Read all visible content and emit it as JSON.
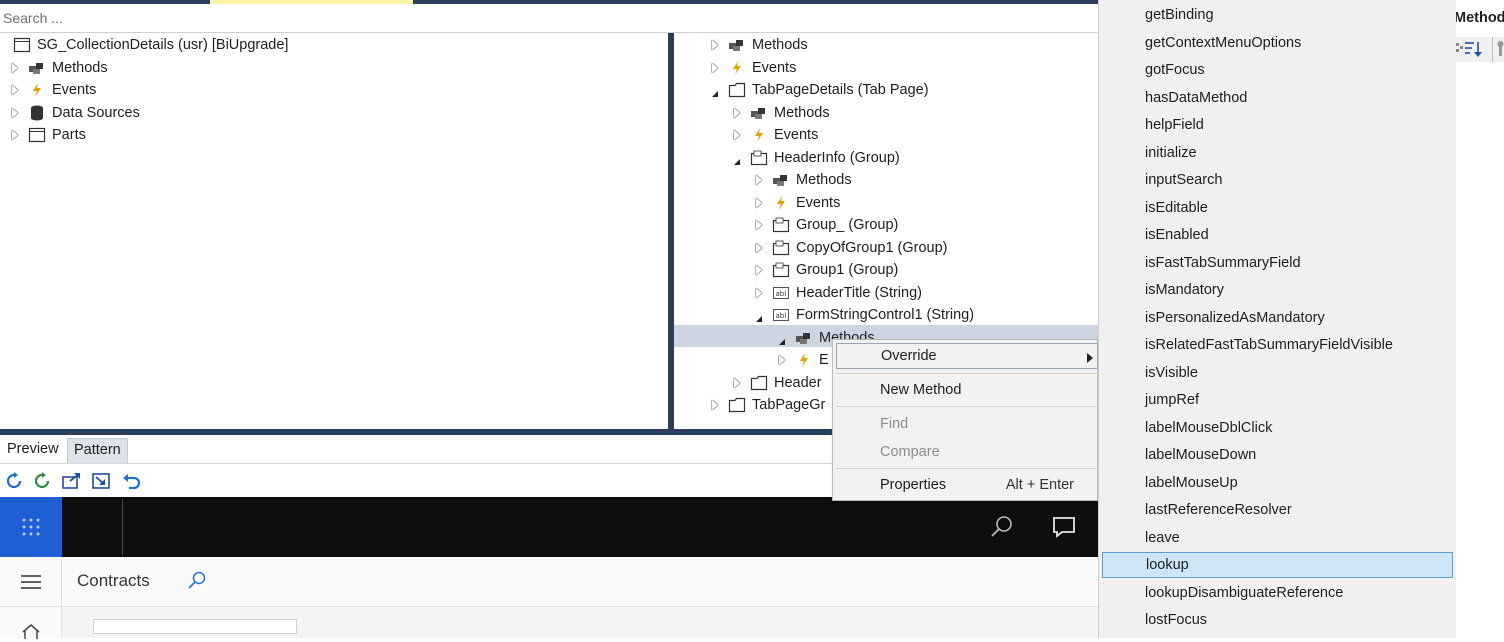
{
  "search": {
    "placeholder": "Search ..."
  },
  "left_tree": {
    "root": "SG_CollectionDetails (usr) [BiUpgrade]",
    "items": [
      "Methods",
      "Events",
      "Data Sources",
      "Parts"
    ]
  },
  "right_tree": {
    "items": [
      "Methods",
      "Events",
      "TabPageDetails (Tab Page)",
      "Methods",
      "Events",
      "HeaderInfo (Group)",
      "Methods",
      "Events",
      "Group_ (Group)",
      "CopyOfGroup1 (Group)",
      "Group1 (Group)",
      "HeaderTitle (String)",
      "FormStringControl1 (String)",
      "Methods",
      "E",
      "Header",
      "TabPageGr"
    ]
  },
  "context_menu": {
    "override": "Override",
    "new_method": "New Method",
    "find": "Find",
    "compare": "Compare",
    "properties": "Properties",
    "properties_shortcut": "Alt + Enter"
  },
  "method_list": {
    "items": [
      "getBinding",
      "getContextMenuOptions",
      "gotFocus",
      "hasDataMethod",
      "helpField",
      "initialize",
      "inputSearch",
      "isEditable",
      "isEnabled",
      "isFastTabSummaryField",
      "isMandatory",
      "isPersonalizedAsMandatory",
      "isRelatedFastTabSummaryFieldVisible",
      "isVisible",
      "jumpRef",
      "labelMouseDblClick",
      "labelMouseDown",
      "labelMouseUp",
      "lastReferenceResolver",
      "leave",
      "lookup",
      "lookupDisambiguateReference",
      "lostFocus"
    ],
    "selected": "lookup"
  },
  "far_right": {
    "label": "Method"
  },
  "preview": {
    "tabs": [
      "Preview",
      "Pattern"
    ],
    "page_title": "Contracts"
  },
  "colors": {
    "accent": "#1f5fd6",
    "selection": "#cde6f7",
    "frame": "#2d3e5c"
  }
}
